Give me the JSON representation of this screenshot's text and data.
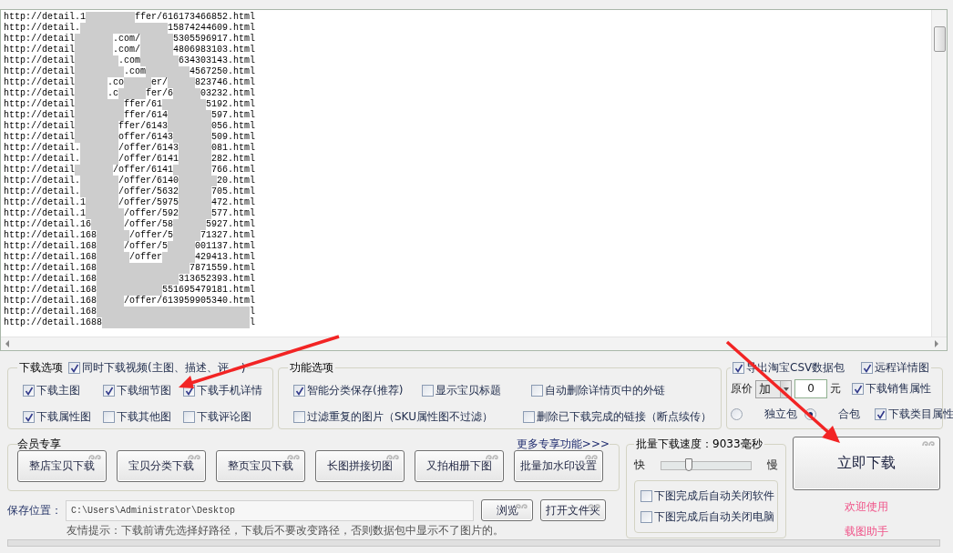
{
  "url_list": {
    "lines": [
      {
        "segments": [
          "http://detail.1",
          "ffer/616173466852.html"
        ]
      },
      {
        "segments": [
          "http://detail.",
          "15874244609.html"
        ]
      },
      {
        "segments": [
          "http://detail",
          ".com/",
          "5305596917.html"
        ]
      },
      {
        "segments": [
          "http://detail",
          ".com/",
          "4806983103.html"
        ]
      },
      {
        "segments": [
          "http://detail",
          ".com",
          "634303143.html"
        ]
      },
      {
        "segments": [
          "http://detail",
          ".com",
          "4567250.html"
        ]
      },
      {
        "segments": [
          "http://detail",
          ".co",
          "er/",
          "823746.html"
        ]
      },
      {
        "segments": [
          "http://detail",
          ".c",
          "fer/6",
          "03232.html"
        ]
      },
      {
        "segments": [
          "http://detail",
          "ffer/61",
          "5192.html"
        ]
      },
      {
        "segments": [
          "http://detail",
          "ffer/614",
          "597.html"
        ]
      },
      {
        "segments": [
          "http://detail",
          "ffer/6143",
          "056.html"
        ]
      },
      {
        "segments": [
          "http://detail",
          "offer/6143",
          "509.html"
        ]
      },
      {
        "segments": [
          "http://detail.",
          "/offer/6143",
          "081.html"
        ]
      },
      {
        "segments": [
          "http://detail.",
          "/offer/6141",
          "282.html"
        ]
      },
      {
        "segments": [
          "http://detail",
          "/offer/6141",
          "766.html"
        ]
      },
      {
        "segments": [
          "http://detail.",
          "/offer/6140",
          "20.html"
        ]
      },
      {
        "segments": [
          "http://detail.",
          "/offer/5632",
          "705.html"
        ]
      },
      {
        "segments": [
          "http://detail.1",
          "/offer/5975",
          "472.html"
        ]
      },
      {
        "segments": [
          "http://detail.1",
          "/offer/592",
          "577.html"
        ]
      },
      {
        "segments": [
          "http://detail.16",
          "/offer/58",
          "5927.html"
        ]
      },
      {
        "segments": [
          "http://detail.168",
          "/offer/5",
          "71327.html"
        ]
      },
      {
        "segments": [
          "http://detail.168",
          "/offer/5",
          "001137.html"
        ]
      },
      {
        "segments": [
          "http://detail.168",
          "/offer",
          "429413.html"
        ]
      },
      {
        "segments": [
          "http://detail.168",
          "7871559.html"
        ]
      },
      {
        "segments": [
          "http://detail.168",
          "313652393.html"
        ]
      },
      {
        "segments": [
          "http://detail.168",
          "551695479181.html"
        ]
      },
      {
        "segments": [
          "http://detail.168",
          "/offer/613959905340.html"
        ]
      },
      {
        "segments": [
          "http://detail.168",
          "l"
        ]
      },
      {
        "segments": [
          "http://detail.1688",
          "l"
        ]
      }
    ]
  },
  "download_options": {
    "title": "下载选项",
    "video": {
      "label": "同时下载视频(主图、描述、评",
      "label_end": ")",
      "checked": true
    },
    "rows": [
      [
        {
          "label": "下载主图",
          "checked": true
        },
        {
          "label": "下载细节图",
          "checked": true
        },
        {
          "label": "下载手机详情",
          "checked": true
        }
      ],
      [
        {
          "label": "下载属性图",
          "checked": true
        },
        {
          "label": "下载其他图",
          "checked": false
        },
        {
          "label": "下载评论图",
          "checked": false
        }
      ]
    ]
  },
  "feature_options": {
    "title": "功能选项",
    "items": [
      {
        "label": "智能分类保存(推荐)",
        "checked": true
      },
      {
        "label": "显示宝贝标题",
        "checked": false
      },
      {
        "label": "自动删除详情页中的外链",
        "checked": false
      },
      {
        "label": "过滤重复的图片（SKU属性图不过滤）",
        "checked": false
      },
      {
        "label": "删除已下载完成的链接（断点续传）",
        "checked": false
      }
    ]
  },
  "export": {
    "csv": {
      "label": "导出淘宝CSV数据包",
      "checked": true
    },
    "remote": {
      "label": "远程详情图",
      "checked": true
    },
    "price_label": "原价",
    "price_mode": "加",
    "price_value": "0",
    "unit": "元",
    "sale_attr": {
      "label": "下载销售属性",
      "checked": true
    },
    "packages": [
      {
        "label": "独立包",
        "selected": false
      },
      {
        "label": "合包",
        "selected": true
      }
    ],
    "category_attr": {
      "label": "下载类目属性",
      "checked": true
    }
  },
  "member": {
    "title": "会员专享",
    "more_link": "更多专享功能>>>",
    "buttons": [
      "整店宝贝下载",
      "宝贝分类下载",
      "整页宝贝下载",
      "长图拼接切图",
      "又拍相册下图",
      "批量加水印设置"
    ]
  },
  "save": {
    "label": "保存位置：",
    "path": "C:\\Users\\Administrator\\Desktop",
    "browse": "浏览",
    "open": "打开文件夹",
    "hint": "友情提示：下载前请先选择好路径，下载后不要改变路径，否则数据包中显示不了图片的。"
  },
  "speed": {
    "title": "批量下载速度：9033毫秒",
    "fast": "快",
    "slow": "慢",
    "level": 0.31,
    "options": [
      {
        "label": "下图完成后自动关闭软件",
        "checked": false
      },
      {
        "label": "下图完成后自动关闭电脑",
        "checked": false
      }
    ]
  },
  "start_button": "立即下载",
  "welcome": [
    "欢迎使用",
    "载图助手"
  ]
}
